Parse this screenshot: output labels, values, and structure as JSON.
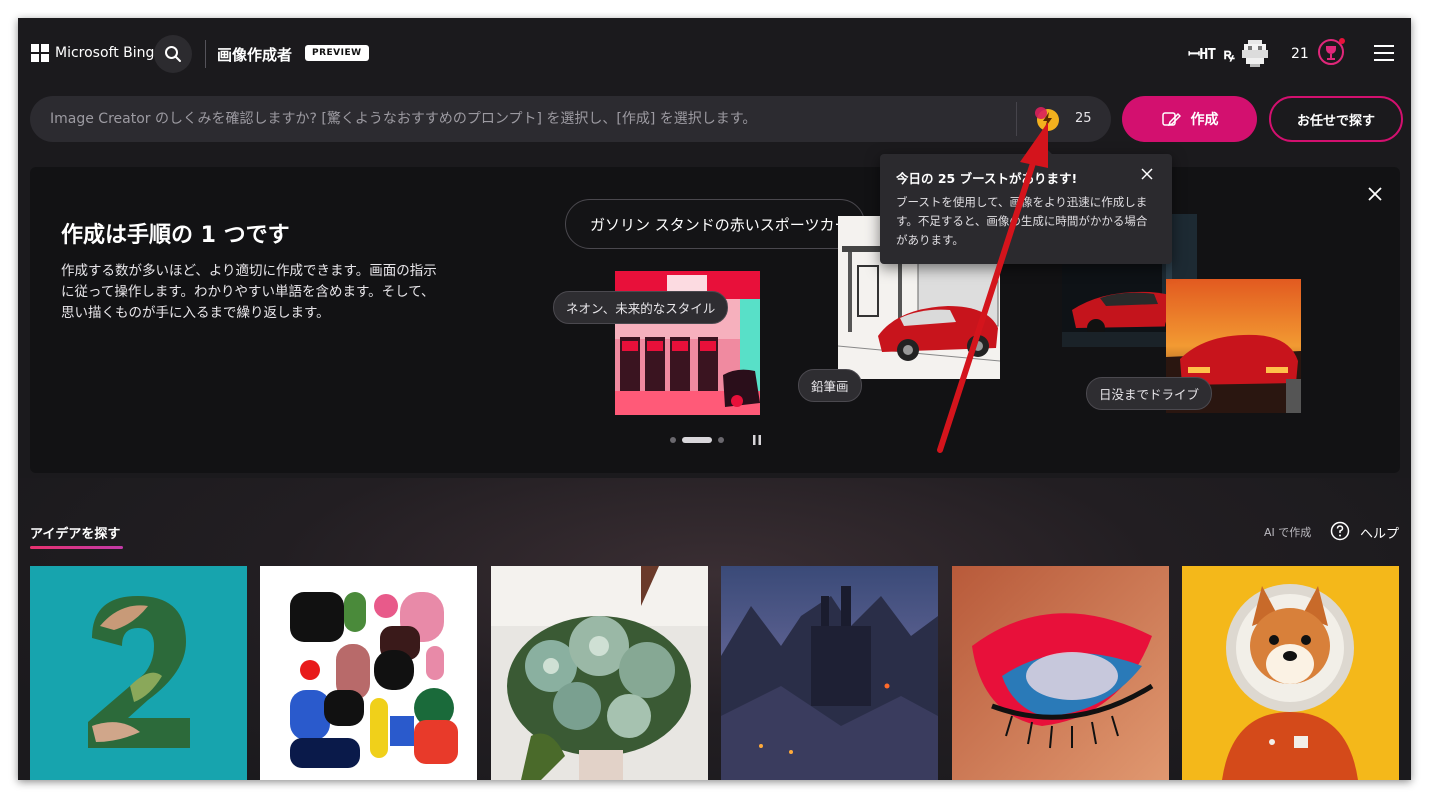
{
  "header": {
    "brand": "Microsoft Bing",
    "app_title": "画像作成者",
    "preview_badge": "PREVIEW",
    "user_name": "ꟷHT ꝶ",
    "reward_count": "21"
  },
  "prompt": {
    "placeholder": "Image Creator のしくみを確認しますか? [驚くようなおすすめのプロンプト] を選択し、[作成] を選択します。",
    "boost_count": "25",
    "create_label": "作成",
    "surprise_label": "お任せで探す"
  },
  "hero": {
    "title": "作成は手順の 1 つです",
    "description": "作成する数が多いほど、より適切に作成できます。画面の指示に従って操作します。わかりやすい単語を含めます。そして、思い描くものが手に入るまで繰り返します。",
    "example_prompt": "ガソリン スタンドの赤いスポーツカー",
    "tags": [
      "ネオン、未来的なスタイル",
      "鉛筆画",
      "日没までドライブ"
    ]
  },
  "tooltip": {
    "title": "今日の 25 ブーストがあります!",
    "body": "ブーストを使用して、画像をより迅速に作成します。不足すると、画像の生成に時間がかかる場合があります。"
  },
  "ideas": {
    "tab_label": "アイデアを探す",
    "ai_link": "AI で作成",
    "help_label": "ヘルプ"
  },
  "colors": {
    "accent": "#d3106f",
    "background": "#1b1a1d",
    "hero_bg": "#121214"
  },
  "icons": {
    "search": "search-icon",
    "menu": "hamburger-menu-icon",
    "boost": "lightning-boost-icon",
    "reward": "trophy-reward-icon",
    "create": "pen-brush-icon",
    "close": "close-icon",
    "help": "question-circle-icon",
    "pause": "pause-icon"
  }
}
